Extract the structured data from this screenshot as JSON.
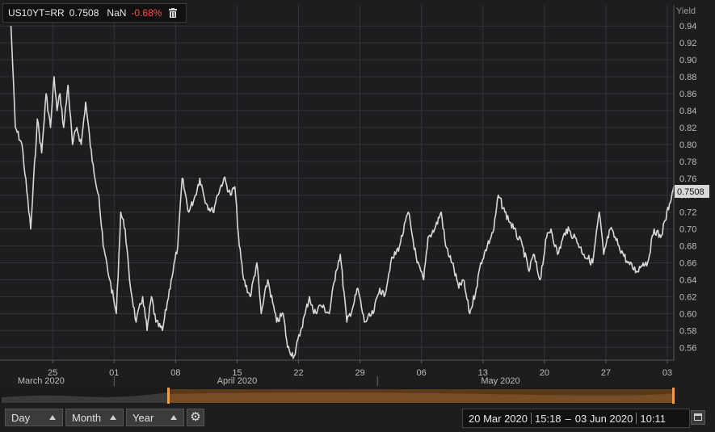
{
  "legend": {
    "symbol": "US10YT=RR",
    "price": "0.7508",
    "nan": "NaN",
    "change": "-0.68%",
    "change_color": "#ff4a4a",
    "icon": "trash-icon"
  },
  "last_value_badge": "0.7508",
  "controls": {
    "day_label": "Day",
    "month_label": "Month",
    "year_label": "Year",
    "settings_icon": "gear-icon",
    "range_start_date": "20 Mar 2020",
    "range_start_time": "15:18",
    "range_dash": "–",
    "range_end_date": "03 Jun 2020",
    "range_end_time": "10:11",
    "calendar_icon": "calendar-icon"
  },
  "chart_data": {
    "type": "line",
    "title": "",
    "ylabel": "Yield",
    "xlabel": "",
    "ylim": [
      0.545,
      0.965
    ],
    "y_ticks": [
      "0.94",
      "0.92",
      "0.90",
      "0.88",
      "0.86",
      "0.84",
      "0.82",
      "0.80",
      "0.78",
      "0.76",
      "0.74",
      "0.72",
      "0.70",
      "0.68",
      "0.66",
      "0.64",
      "0.62",
      "0.60",
      "0.58",
      "0.56"
    ],
    "x_ticks": [
      "25",
      "01",
      "08",
      "15",
      "22",
      "29",
      "06",
      "13",
      "20",
      "27",
      "03"
    ],
    "month_labels": [
      "March 2020",
      "April 2020",
      "May 2020"
    ],
    "grid": true,
    "line_color": "#d9d9d9",
    "series": [
      {
        "name": "",
        "x": [
          "2020-03-20",
          "2020-03-20",
          "2020-03-21",
          "2020-03-22",
          "2020-03-23",
          "2020-03-23",
          "2020-03-24",
          "2020-03-24",
          "2020-03-25",
          "2020-03-25",
          "2020-03-25",
          "2020-03-26",
          "2020-03-26",
          "2020-03-27",
          "2020-03-27",
          "2020-03-28",
          "2020-03-28",
          "2020-03-29",
          "2020-03-30",
          "2020-03-30",
          "2020-03-31",
          "2020-04-01",
          "2020-04-01",
          "2020-04-02",
          "2020-04-02",
          "2020-04-03",
          "2020-04-04",
          "2020-04-04",
          "2020-04-05",
          "2020-04-05",
          "2020-04-06",
          "2020-04-07",
          "2020-04-08",
          "2020-04-08",
          "2020-04-09",
          "2020-04-10",
          "2020-04-10",
          "2020-04-11",
          "2020-04-12",
          "2020-04-12",
          "2020-04-13",
          "2020-04-14",
          "2020-04-14",
          "2020-04-15",
          "2020-04-15",
          "2020-04-16",
          "2020-04-17",
          "2020-04-17",
          "2020-04-18",
          "2020-04-19",
          "2020-04-20",
          "2020-04-20",
          "2020-04-21",
          "2020-04-22",
          "2020-04-22",
          "2020-04-23",
          "2020-04-23",
          "2020-04-24",
          "2020-04-25",
          "2020-04-26",
          "2020-04-26",
          "2020-04-27",
          "2020-04-28",
          "2020-04-28",
          "2020-04-29",
          "2020-04-30",
          "2020-05-01",
          "2020-05-01",
          "2020-05-02",
          "2020-05-03",
          "2020-05-04",
          "2020-05-05",
          "2020-05-06",
          "2020-05-06",
          "2020-05-07",
          "2020-05-08",
          "2020-05-08",
          "2020-05-09",
          "2020-05-10",
          "2020-05-10",
          "2020-05-11",
          "2020-05-12",
          "2020-05-12",
          "2020-05-13",
          "2020-05-14",
          "2020-05-14",
          "2020-05-15",
          "2020-05-16",
          "2020-05-17",
          "2020-05-18",
          "2020-05-18",
          "2020-05-19",
          "2020-05-20",
          "2020-05-20",
          "2020-05-21",
          "2020-05-22",
          "2020-05-23",
          "2020-05-24",
          "2020-05-25",
          "2020-05-26",
          "2020-05-26",
          "2020-05-27",
          "2020-05-28",
          "2020-05-29",
          "2020-05-30",
          "2020-05-31",
          "2020-05-31",
          "2020-06-01",
          "2020-06-02",
          "2020-06-02",
          "2020-06-03",
          "2020-06-03"
        ],
        "y": [
          0.94,
          0.82,
          0.8,
          0.7,
          0.83,
          0.79,
          0.86,
          0.82,
          0.88,
          0.84,
          0.86,
          0.82,
          0.87,
          0.8,
          0.82,
          0.8,
          0.85,
          0.78,
          0.74,
          0.68,
          0.64,
          0.6,
          0.72,
          0.7,
          0.64,
          0.59,
          0.62,
          0.58,
          0.62,
          0.59,
          0.58,
          0.64,
          0.68,
          0.76,
          0.72,
          0.74,
          0.76,
          0.73,
          0.72,
          0.74,
          0.76,
          0.74,
          0.75,
          0.68,
          0.64,
          0.62,
          0.66,
          0.6,
          0.64,
          0.59,
          0.6,
          0.56,
          0.55,
          0.58,
          0.6,
          0.62,
          0.6,
          0.61,
          0.6,
          0.65,
          0.67,
          0.59,
          0.61,
          0.63,
          0.59,
          0.6,
          0.63,
          0.62,
          0.66,
          0.68,
          0.72,
          0.66,
          0.64,
          0.69,
          0.7,
          0.72,
          0.68,
          0.66,
          0.63,
          0.64,
          0.6,
          0.63,
          0.66,
          0.68,
          0.7,
          0.74,
          0.72,
          0.7,
          0.68,
          0.65,
          0.67,
          0.64,
          0.69,
          0.7,
          0.67,
          0.7,
          0.69,
          0.67,
          0.66,
          0.72,
          0.67,
          0.7,
          0.68,
          0.66,
          0.65,
          0.66,
          0.66,
          0.7,
          0.69,
          0.71,
          0.73,
          0.7508
        ]
      }
    ]
  }
}
